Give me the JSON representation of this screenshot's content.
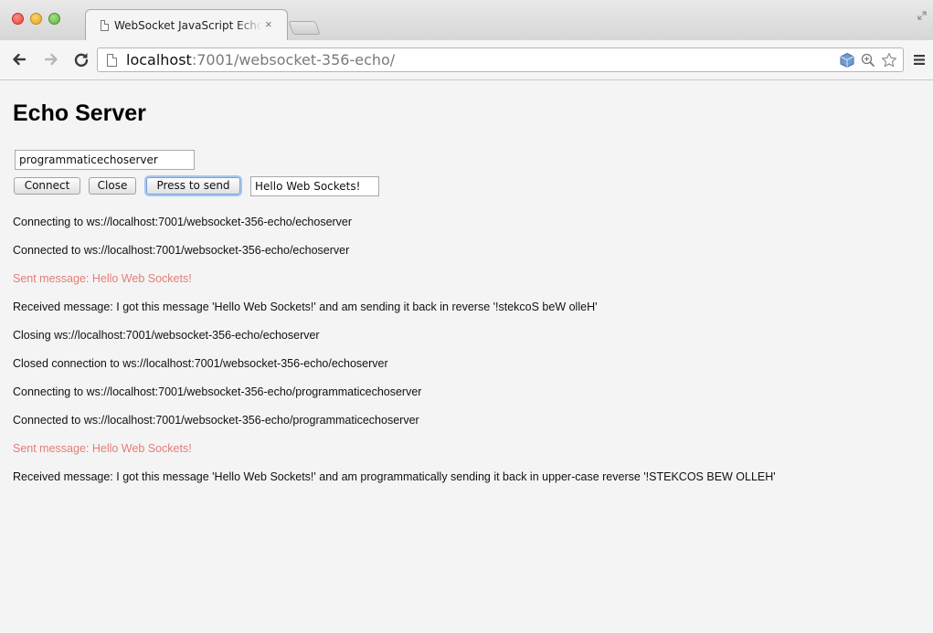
{
  "browser": {
    "tab_title": "WebSocket JavaScript Echo",
    "tab_close_glyph": "×",
    "url_host": "localhost",
    "url_path": ":7001/websocket-356-echo/",
    "icons": [
      "back-arrow-icon",
      "forward-arrow-icon",
      "reload-icon",
      "page-icon",
      "extension-cube-icon",
      "zoom-icon",
      "star-icon",
      "menu-icon",
      "fullscreen-icon"
    ]
  },
  "page": {
    "title": "Echo Server",
    "endpoint_value": "programmaticechoserver",
    "buttons": {
      "connect": "Connect",
      "close": "Close",
      "send": "Press to send"
    },
    "message_value": "Hello Web Sockets!"
  },
  "log": [
    {
      "text": "Connecting to ws://localhost:7001/websocket-356-echo/echoserver",
      "kind": "info"
    },
    {
      "text": "Connected to ws://localhost:7001/websocket-356-echo/echoserver",
      "kind": "info"
    },
    {
      "text": "Sent message: Hello Web Sockets!",
      "kind": "sent"
    },
    {
      "text": "Received message: I got this message 'Hello Web Sockets!' and am sending it back in reverse '!stekcoS beW olleH'",
      "kind": "info"
    },
    {
      "text": "Closing ws://localhost:7001/websocket-356-echo/echoserver",
      "kind": "info"
    },
    {
      "text": "Closed connection to ws://localhost:7001/websocket-356-echo/echoserver",
      "kind": "info"
    },
    {
      "text": "Connecting to ws://localhost:7001/websocket-356-echo/programmaticechoserver",
      "kind": "info"
    },
    {
      "text": "Connected to ws://localhost:7001/websocket-356-echo/programmaticechoserver",
      "kind": "info"
    },
    {
      "text": "Sent message: Hello Web Sockets!",
      "kind": "sent"
    },
    {
      "text": "Received message: I got this message 'Hello Web Sockets!' and am programmatically sending it back in upper-case reverse '!STEKCOS BEW OLLEH'",
      "kind": "info"
    }
  ],
  "colors": {
    "sent_message": "#e47d78",
    "focus_ring": "#a9c7ef"
  }
}
